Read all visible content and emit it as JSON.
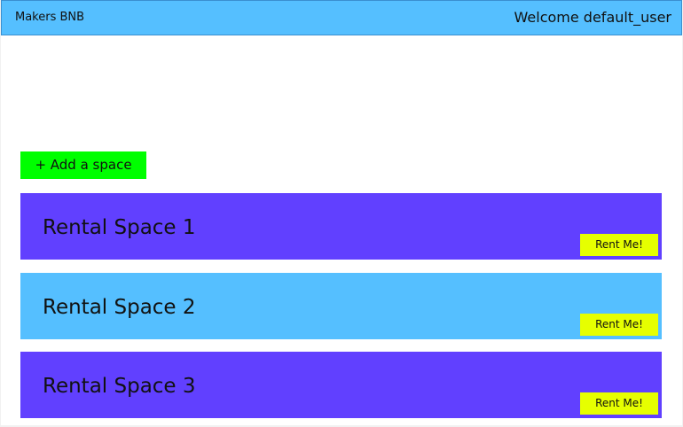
{
  "header": {
    "brand": "Makers BNB",
    "welcome": "Welcome default_user"
  },
  "actions": {
    "add_space_label": "+ Add a space"
  },
  "spaces": [
    {
      "title": "Rental Space 1",
      "rent_label": "Rent Me!",
      "color": "#6140ff"
    },
    {
      "title": "Rental Space 2",
      "rent_label": "Rent Me!",
      "color": "#55bfff"
    },
    {
      "title": "Rental Space 3",
      "rent_label": "Rent Me!",
      "color": "#6140ff"
    }
  ],
  "colors": {
    "header_bg": "#55bfff",
    "add_button_bg": "#00ff00",
    "rent_button_bg": "#e6ff00"
  }
}
